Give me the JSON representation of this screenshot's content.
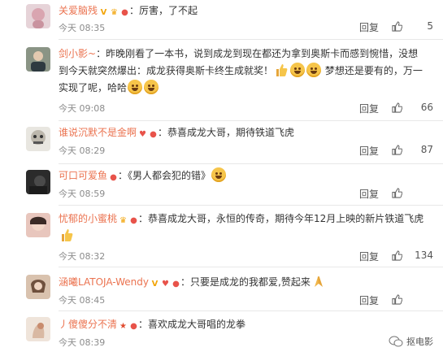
{
  "comments": [
    {
      "name": "关爱脑残",
      "text": "：厉害，了不起",
      "time": "今天 08:35",
      "reply_label": "回复",
      "likes": "5",
      "avatar_color": "#d9c0c6"
    },
    {
      "name": "剑小影~",
      "text": "：昨晚刚看了一本书，说到成龙到现在都还为拿到奥斯卡而感到惋惜，没想到今天就突然爆出：成龙获得奥斯卡终生成就奖！",
      "text2": " 梦想还是要有的，万一实现了呢，哈哈",
      "time": "今天 09:08",
      "reply_label": "回复",
      "likes": "66",
      "avatar_color": "#6f7b68"
    },
    {
      "name": "谁说沉默不是金啊",
      "text": "：恭喜成龙大哥，期待铁道飞虎",
      "time": "今天 08:29",
      "reply_label": "回复",
      "likes": "87",
      "avatar_color": "#b5b1a8"
    },
    {
      "name": "可口可爱鱼",
      "text": "：《男人都会犯的错》",
      "time": "今天 08:59",
      "reply_label": "回复",
      "likes": "",
      "avatar_color": "#3a3a3a"
    },
    {
      "name": "忧郁的小蜜桃",
      "text": "：恭喜成龙大哥，永恒的传奇，期待今年12月上映的新片铁道飞虎",
      "time": "今天 08:32",
      "reply_label": "回复",
      "likes": "134",
      "avatar_color": "#c98a7a"
    },
    {
      "name": "涵曦LATOJA-Wendy",
      "text": "：只要是成龙的我都爱,赞起来",
      "time": "今天 08:45",
      "reply_label": "回复",
      "likes": "",
      "avatar_color": "#a07a5f"
    },
    {
      "name": "丿傻傻分不清",
      "text": "：喜欢成龙大哥唱的龙拳",
      "time": "今天 08:39",
      "reply_label": "",
      "likes": "",
      "avatar_color": "#c9b5a5"
    }
  ],
  "watermark": {
    "label": "抠电影"
  },
  "colors": {
    "name": "#eb7350",
    "text": "#333333",
    "meta": "#8c8c8c",
    "divider": "#e8e8e8"
  }
}
